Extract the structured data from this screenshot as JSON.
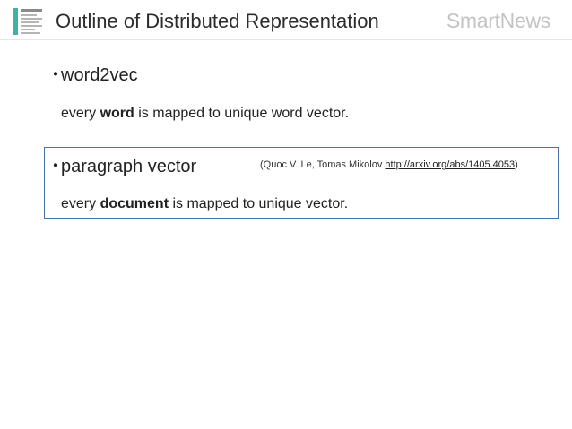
{
  "header": {
    "title": "Outline of Distributed Representation",
    "brand": "SmartNews"
  },
  "sections": [
    {
      "bullet": "・",
      "heading": "word2vec",
      "desc_prefix": "every ",
      "desc_bold": "word",
      "desc_suffix": " is mapped to unique word vector."
    },
    {
      "bullet": "・",
      "heading": "paragraph vector",
      "citation_open": "(Quoc V. Le, Tomas Mikolov ",
      "citation_link": "http://arxiv.org/abs/1405.4053",
      "citation_close": ")",
      "desc_prefix": "every ",
      "desc_bold": "document",
      "desc_suffix": " is mapped to unique vector."
    }
  ],
  "colors": {
    "box_border": "#4a72b0",
    "brand": "#c4c4c4",
    "logo_accent": "#3fb3a3"
  },
  "icons": {
    "logo": "document-layout-icon"
  }
}
